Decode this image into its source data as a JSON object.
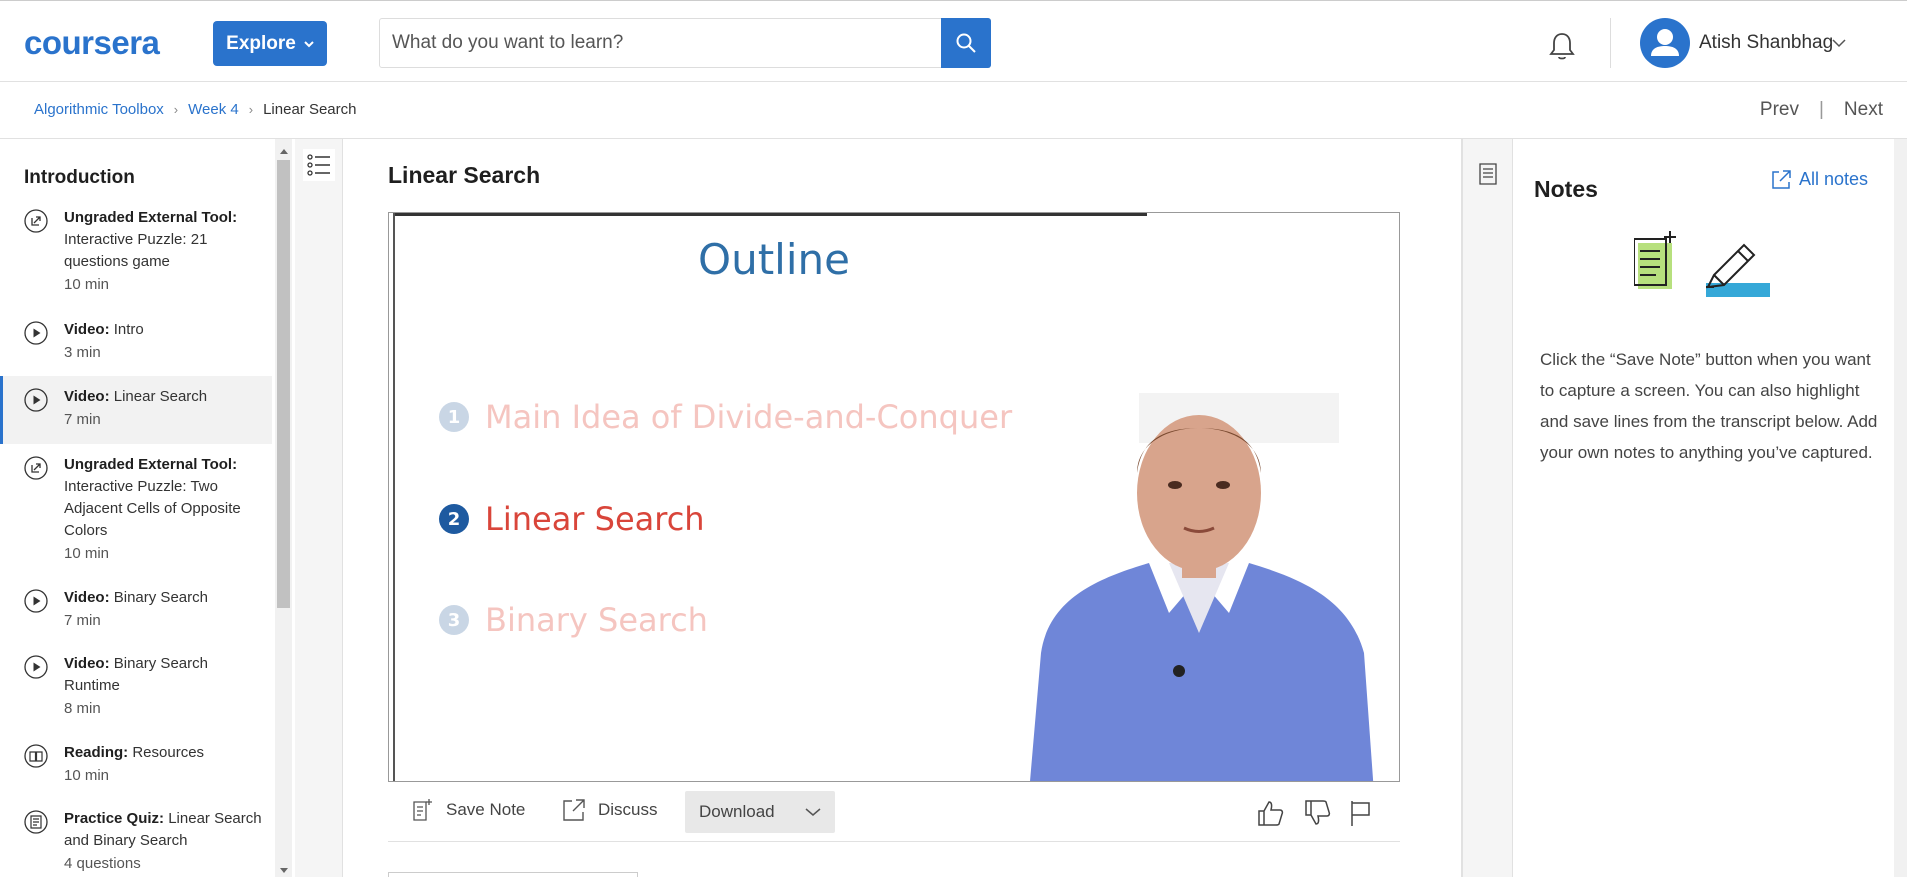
{
  "header": {
    "logo_text": "coursera",
    "explore_label": "Explore",
    "search_placeholder": "What do you want to learn?",
    "user_name": "Atish Shanbhag"
  },
  "breadcrumb": {
    "items": [
      "Algorithmic Toolbox",
      "Week 4"
    ],
    "current": "Linear Search"
  },
  "nav": {
    "prev": "Prev",
    "sep": "|",
    "next": "Next"
  },
  "sidebar": {
    "title": "Introduction",
    "items": [
      {
        "type": "Ungraded External Tool:",
        "name": "Interactive Puzzle: 21 questions game",
        "meta": "10 min",
        "icon": "external-tool-icon",
        "active": false
      },
      {
        "type": "Video:",
        "name": "Intro",
        "meta": "3 min",
        "icon": "play-icon",
        "active": false
      },
      {
        "type": "Video:",
        "name": "Linear Search",
        "meta": "7 min",
        "icon": "play-icon",
        "active": true
      },
      {
        "type": "Ungraded External Tool:",
        "name": "Interactive Puzzle: Two Adjacent Cells of Opposite Colors",
        "meta": "10 min",
        "icon": "external-tool-icon",
        "active": false
      },
      {
        "type": "Video:",
        "name": "Binary Search",
        "meta": "7 min",
        "icon": "play-icon",
        "active": false
      },
      {
        "type": "Video:",
        "name": "Binary Search Runtime",
        "meta": "8 min",
        "icon": "play-icon",
        "active": false
      },
      {
        "type": "Reading:",
        "name": "Resources",
        "meta": "10 min",
        "icon": "book-icon",
        "active": false
      },
      {
        "type": "Practice Quiz:",
        "name": "Linear Search and Binary Search",
        "meta": "4 questions",
        "icon": "quiz-icon",
        "active": false
      }
    ]
  },
  "lesson": {
    "title": "Linear Search",
    "slide": {
      "title": "Outline",
      "items": [
        {
          "num": "1",
          "text": "Main Idea of Divide-and-Conquer",
          "state": "faded"
        },
        {
          "num": "2",
          "text": "Linear Search",
          "state": "current"
        },
        {
          "num": "3",
          "text": "Binary Search",
          "state": "faded"
        }
      ]
    },
    "toolbar": {
      "save_note": "Save Note",
      "discuss": "Discuss",
      "download": "Download"
    }
  },
  "notes": {
    "title": "Notes",
    "all_notes": "All notes",
    "description": "Click the “Save Note” button when you want to capture a screen. You can also highlight and save lines from the transcript below. Add your own notes to anything you’ve captured."
  },
  "colors": {
    "brand_blue": "#2a73cc",
    "slide_title_blue": "#2f6fa7",
    "slide_red": "#d9453a"
  }
}
